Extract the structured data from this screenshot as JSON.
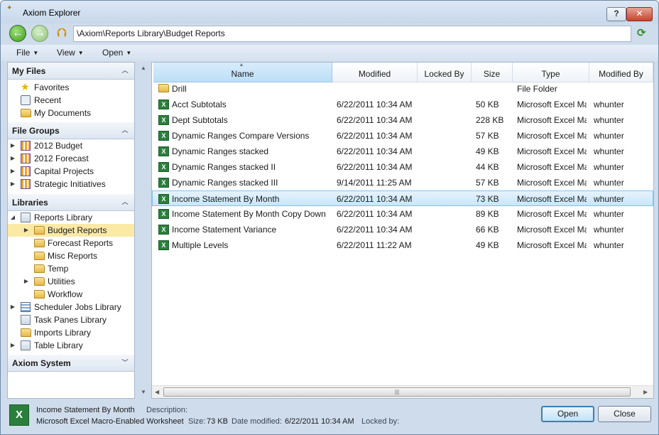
{
  "window": {
    "title": "Axiom Explorer",
    "help_label": "?",
    "close_label": "✕"
  },
  "nav": {
    "address": "\\Axiom\\Reports Library\\Budget Reports",
    "back_glyph": "←",
    "forward_glyph": "→"
  },
  "menu": {
    "file": "File",
    "view": "View",
    "open": "Open"
  },
  "left": {
    "my_files": {
      "header": "My Files",
      "items": [
        "Favorites",
        "Recent",
        "My Documents"
      ]
    },
    "file_groups": {
      "header": "File Groups",
      "items": [
        "2012 Budget",
        "2012 Forecast",
        "Capital Projects",
        "Strategic Initiatives"
      ]
    },
    "libraries": {
      "header": "Libraries",
      "items": [
        "Reports Library",
        "Budget Reports",
        "Forecast Reports",
        "Misc Reports",
        "Temp",
        "Utilities",
        "Workflow",
        "Scheduler Jobs Library",
        "Task Panes Library",
        "Imports Library",
        "Table Library"
      ]
    },
    "axiom_system": {
      "header": "Axiom System"
    }
  },
  "columns": {
    "name": "Name",
    "modified": "Modified",
    "locked_by": "Locked By",
    "size": "Size",
    "type": "Type",
    "modified_by": "Modified By"
  },
  "files": [
    {
      "name": "Drill",
      "modified": "",
      "size": "",
      "type": "File Folder",
      "by": "",
      "icon": "folder-icon"
    },
    {
      "name": "Acct Subtotals",
      "modified": "6/22/2011 10:34 AM",
      "size": "50 KB",
      "type": "Microsoft Excel Ma",
      "by": "whunter",
      "icon": "excel-icon"
    },
    {
      "name": "Dept Subtotals",
      "modified": "6/22/2011 10:34 AM",
      "size": "228 KB",
      "type": "Microsoft Excel Ma",
      "by": "whunter",
      "icon": "excel-icon"
    },
    {
      "name": "Dynamic Ranges Compare Versions",
      "modified": "6/22/2011 10:34 AM",
      "size": "57 KB",
      "type": "Microsoft Excel Ma",
      "by": "whunter",
      "icon": "excel-icon"
    },
    {
      "name": "Dynamic Ranges stacked",
      "modified": "6/22/2011 10:34 AM",
      "size": "49 KB",
      "type": "Microsoft Excel Ma",
      "by": "whunter",
      "icon": "excel-icon"
    },
    {
      "name": "Dynamic Ranges stacked II",
      "modified": "6/22/2011 10:34 AM",
      "size": "44 KB",
      "type": "Microsoft Excel Ma",
      "by": "whunter",
      "icon": "excel-icon"
    },
    {
      "name": "Dynamic Ranges stacked III",
      "modified": "9/14/2011 11:25 AM",
      "size": "57 KB",
      "type": "Microsoft Excel Ma",
      "by": "whunter",
      "icon": "excel-icon"
    },
    {
      "name": "Income Statement By Month",
      "modified": "6/22/2011 10:34 AM",
      "size": "73 KB",
      "type": "Microsoft Excel Ma",
      "by": "whunter",
      "icon": "excel-icon"
    },
    {
      "name": "Income Statement By Month Copy Down",
      "modified": "6/22/2011 10:34 AM",
      "size": "89 KB",
      "type": "Microsoft Excel Ma",
      "by": "whunter",
      "icon": "excel-icon"
    },
    {
      "name": "Income Statement Variance",
      "modified": "6/22/2011 10:34 AM",
      "size": "66 KB",
      "type": "Microsoft Excel Ma",
      "by": "whunter",
      "icon": "excel-icon"
    },
    {
      "name": "Multiple Levels",
      "modified": "6/22/2011 11:22 AM",
      "size": "49 KB",
      "type": "Microsoft Excel Ma",
      "by": "whunter",
      "icon": "excel-icon"
    }
  ],
  "status": {
    "file_name": "Income Statement By Month",
    "description_label": "Description:",
    "file_type": "Microsoft Excel Macro-Enabled Worksheet",
    "size_label": "Size:",
    "size_value": "73 KB",
    "date_label": "Date modified:",
    "date_value": "6/22/2011 10:34 AM",
    "locked_label": "Locked by:"
  },
  "buttons": {
    "open": "Open",
    "close": "Close"
  }
}
